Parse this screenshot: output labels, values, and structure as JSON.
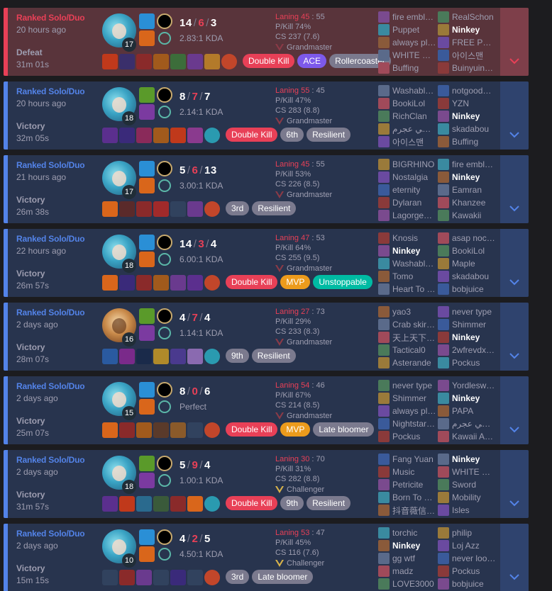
{
  "matches": [
    {
      "queue": "Ranked Solo/Duo",
      "ago": "20 hours ago",
      "result": "Defeat",
      "duration": "31m 01s",
      "outcome": "loss",
      "champ_variant": "main",
      "level": "17",
      "kills": "14",
      "deaths": "6",
      "assists": "3",
      "ratio": "2.83:1 KDA",
      "laning_label": "Laning 45",
      "laning_opp": "55",
      "pkill": "P/Kill 74%",
      "cs": "CS 237 (7.6)",
      "tier": "Grandmaster",
      "tier_type": "gm",
      "badges": [
        {
          "label": "Double Kill",
          "color": "red"
        },
        {
          "label": "ACE",
          "color": "purple"
        },
        {
          "label": "Rollercoaster",
          "color": "gray"
        }
      ],
      "items": [
        "#c0391b",
        "#3a2f6b",
        "#8a2a2a",
        "#a15a1c",
        "#3c6d3a",
        "#6a3a8e",
        "#b37a2a",
        "#c2462a"
      ],
      "team1": [
        "fire embl…",
        "Puppet",
        "always pl…",
        "WHITE C…",
        "Buffing"
      ],
      "team2": [
        "RealSchon",
        "Ninkey",
        "FREE PE…",
        "아이스맨",
        "Buinyuin…"
      ],
      "me": "team2.1"
    },
    {
      "queue": "Ranked Solo/Duo",
      "ago": "20 hours ago",
      "result": "Victory",
      "duration": "32m 05s",
      "outcome": "win",
      "champ_variant": "main",
      "level": "18",
      "kills": "8",
      "deaths": "7",
      "assists": "7",
      "ratio": "2.14:1 KDA",
      "laning_label": "Laning 55",
      "laning_opp": "45",
      "pkill": "P/Kill 47%",
      "cs": "CS 283 (8.8)",
      "tier": "Grandmaster",
      "tier_type": "gm",
      "badges": [
        {
          "label": "Double Kill",
          "color": "red"
        },
        {
          "label": "6th",
          "color": "gray"
        },
        {
          "label": "Resilient",
          "color": "gray"
        }
      ],
      "items": [
        "#5b2f8e",
        "#3a2a7a",
        "#8a2a5a",
        "#a15a1c",
        "#c0391b",
        "#8a3a8e",
        "#2a9ab0"
      ],
      "team1": [
        "Washabl…",
        "BookiLol",
        "RichClan",
        "تكسي عجرم",
        "아이스맨"
      ],
      "team2": [
        "notgoode…",
        "YZN",
        "Ninkey",
        "skadabou",
        "Buffing"
      ],
      "me": "team2.2"
    },
    {
      "queue": "Ranked Solo/Duo",
      "ago": "21 hours ago",
      "result": "Victory",
      "duration": "26m 38s",
      "outcome": "win",
      "champ_variant": "main",
      "level": "17",
      "kills": "5",
      "deaths": "6",
      "assists": "13",
      "ratio": "3.00:1 KDA",
      "laning_label": "Laning 45",
      "laning_opp": "55",
      "pkill": "P/Kill 53%",
      "cs": "CS 226 (8.5)",
      "tier": "Grandmaster",
      "tier_type": "gm",
      "badges": [
        {
          "label": "3rd",
          "color": "gray"
        },
        {
          "label": "Resilient",
          "color": "gray"
        }
      ],
      "items": [
        "#d9661b",
        "#5a2a2a",
        "#8a2a2a",
        "#a12a2a",
        "empty",
        "#6a3a8e",
        "#c2462a"
      ],
      "team1": [
        "BIGRHINO",
        "Nostalgia",
        "eternity",
        "Dylaran",
        "Lagorgea…"
      ],
      "team2": [
        "fire embl…",
        "Ninkey",
        "Eamran",
        "Khanzee",
        "Kawakii"
      ],
      "me": "team2.1"
    },
    {
      "queue": "Ranked Solo/Duo",
      "ago": "22 hours ago",
      "result": "Victory",
      "duration": "26m 57s",
      "outcome": "win",
      "champ_variant": "main",
      "level": "18",
      "kills": "14",
      "deaths": "3",
      "assists": "4",
      "ratio": "6.00:1 KDA",
      "laning_label": "Laning 47",
      "laning_opp": "53",
      "pkill": "P/Kill 64%",
      "cs": "CS 255 (9.5)",
      "tier": "Grandmaster",
      "tier_type": "gm",
      "badges": [
        {
          "label": "Double Kill",
          "color": "red"
        },
        {
          "label": "MVP",
          "color": "orange"
        },
        {
          "label": "Unstoppable",
          "color": "green"
        }
      ],
      "items": [
        "#d9661b",
        "#3a2a7a",
        "#8a2a2a",
        "#a15a1c",
        "#6a3a8e",
        "#5b2f8e",
        "#c2462a"
      ],
      "team1": [
        "Knosis",
        "Ninkey",
        "Washabl…",
        "Tomo",
        "Heart To …"
      ],
      "team2": [
        "asap noc…",
        "BookiLol",
        "Maple",
        "skadabou",
        "bobjuice"
      ],
      "me": "team1.1"
    },
    {
      "queue": "Ranked Solo/Duo",
      "ago": "2 days ago",
      "result": "Victory",
      "duration": "28m 07s",
      "outcome": "win",
      "champ_variant": "alt",
      "level": "16",
      "kills": "4",
      "deaths": "7",
      "assists": "4",
      "ratio": "1.14:1 KDA",
      "laning_label": "Laning 27",
      "laning_opp": "73",
      "pkill": "P/Kill 29%",
      "cs": "CS 233 (8.3)",
      "tier": "Grandmaster",
      "tier_type": "gm",
      "badges": [
        {
          "label": "9th",
          "color": "gray"
        },
        {
          "label": "Resilient",
          "color": "gray"
        }
      ],
      "items": [
        "#2a5aa0",
        "#7a2a8a",
        "#1a2a4a",
        "#b08a2a",
        "#4a3a8e",
        "#8a6ab0",
        "#2a9ab0"
      ],
      "team1": [
        "yao3",
        "Crab skir…",
        "天上天下…",
        "Tactical0",
        "Asterande"
      ],
      "team2": [
        "never type",
        "Shimmer",
        "Ninkey",
        "2wfrevdx…",
        "Pockus"
      ],
      "me": "team2.2"
    },
    {
      "queue": "Ranked Solo/Duo",
      "ago": "2 days ago",
      "result": "Victory",
      "duration": "25m 07s",
      "outcome": "win",
      "champ_variant": "main",
      "level": "15",
      "kills": "8",
      "deaths": "0",
      "assists": "6",
      "ratio": "Perfect",
      "laning_label": "Laning 54",
      "laning_opp": "46",
      "pkill": "P/Kill 67%",
      "cs": "CS 214 (8.5)",
      "tier": "Grandmaster",
      "tier_type": "gm",
      "badges": [
        {
          "label": "Double Kill",
          "color": "red"
        },
        {
          "label": "MVP",
          "color": "orange"
        },
        {
          "label": "Late bloomer",
          "color": "gray"
        }
      ],
      "items": [
        "#d9661b",
        "#8a2a2a",
        "#a15a1c",
        "#5a3a2a",
        "#8a5a2a",
        "empty",
        "#c2462a"
      ],
      "team1": [
        "never type",
        "Shimmer",
        "always pl…",
        "Nightstar…",
        "Pockus"
      ],
      "team2": [
        "Yordlesw…",
        "Ninkey",
        "PAPA",
        "تكسي عجرم",
        "Kawaii Ar…"
      ],
      "me": "team2.1"
    },
    {
      "queue": "Ranked Solo/Duo",
      "ago": "2 days ago",
      "result": "Victory",
      "duration": "31m 57s",
      "outcome": "win",
      "champ_variant": "main",
      "level": "18",
      "kills": "5",
      "deaths": "9",
      "assists": "4",
      "ratio": "1.00:1 KDA",
      "laning_label": "Laning 30",
      "laning_opp": "70",
      "pkill": "P/Kill 31%",
      "cs": "CS 282 (8.8)",
      "tier": "Challenger",
      "tier_type": "ch",
      "badges": [
        {
          "label": "Double Kill",
          "color": "red"
        },
        {
          "label": "9th",
          "color": "gray"
        },
        {
          "label": "Resilient",
          "color": "gray"
        }
      ],
      "items": [
        "#5b2f8e",
        "#c0391b",
        "#2a6a8e",
        "#3a5a3a",
        "#8a2a2a",
        "#d9661b",
        "#2a9ab0"
      ],
      "team1": [
        "Fang Yuan",
        "Music",
        "Petricite",
        "Born To …",
        "抖音薇信…"
      ],
      "team2": [
        "Ninkey",
        "WHITE C…",
        "Sword",
        "Mobility",
        "Isles"
      ],
      "me": "team2.0"
    },
    {
      "queue": "Ranked Solo/Duo",
      "ago": "2 days ago",
      "result": "Victory",
      "duration": "15m 15s",
      "outcome": "win",
      "champ_variant": "main",
      "level": "10",
      "kills": "4",
      "deaths": "2",
      "assists": "5",
      "ratio": "4.50:1 KDA",
      "laning_label": "Laning 53",
      "laning_opp": "47",
      "pkill": "P/Kill 45%",
      "cs": "CS 116 (7.6)",
      "tier": "Challenger",
      "tier_type": "ch",
      "badges": [
        {
          "label": "3rd",
          "color": "gray"
        },
        {
          "label": "Late bloomer",
          "color": "gray"
        }
      ],
      "items": [
        "empty",
        "#8a2a2a",
        "#6a3a8e",
        "empty",
        "#3a2a7a",
        "empty",
        "#c2462a"
      ],
      "team1": [
        "torchic",
        "Ninkey",
        "gg wtf",
        "madz",
        "LOVE3000"
      ],
      "team2": [
        "philip",
        "Loj Azz",
        "never loo…",
        "Pockus",
        "bobjuice"
      ],
      "me": "team1.1"
    }
  ],
  "colors": {
    "win": "#5383e8",
    "loss": "#e84057",
    "spell_flash": "#2a8fd6",
    "spell_ignite": "#d9661b",
    "spell_tp": "#5b2f8e"
  },
  "icons": {
    "expand": "chevron-down-icon",
    "rune": "keystone-rune-icon",
    "tier": "tier-emblem-icon"
  }
}
